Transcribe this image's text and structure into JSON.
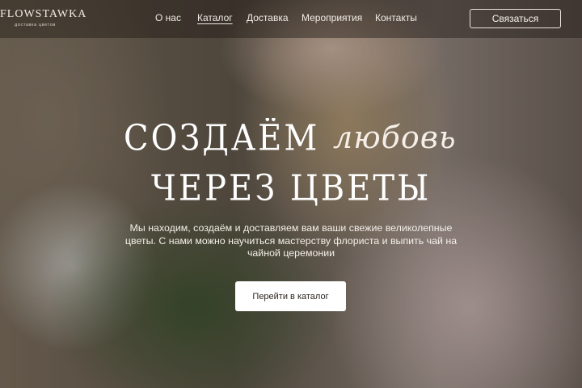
{
  "header": {
    "logo": {
      "name": "FLOWSTAWKA",
      "tagline": "доставка цветов"
    },
    "nav": [
      {
        "label": "О нас",
        "active": false
      },
      {
        "label": "Каталог",
        "active": true
      },
      {
        "label": "Доставка",
        "active": false
      },
      {
        "label": "Мероприятия",
        "active": false
      },
      {
        "label": "Контакты",
        "active": false
      }
    ],
    "contact_button": "Связаться"
  },
  "hero": {
    "title_line1": "СОЗДАЁМ",
    "title_script": "любовь",
    "title_line2": "ЧЕРЕЗ ЦВЕТЫ",
    "description": "Мы находим, создаём и доставляем вам ваши свежие великолепные цветы. С нами можно научиться мастерству флориста и выпить чай на чайной церемонии",
    "cta_button": "Перейти в каталог"
  },
  "colors": {
    "header_bg": "rgba(30,24,20,0.45)",
    "text_light": "#f1ece6",
    "button_bg": "#ffffff",
    "button_text": "#2b2521"
  }
}
